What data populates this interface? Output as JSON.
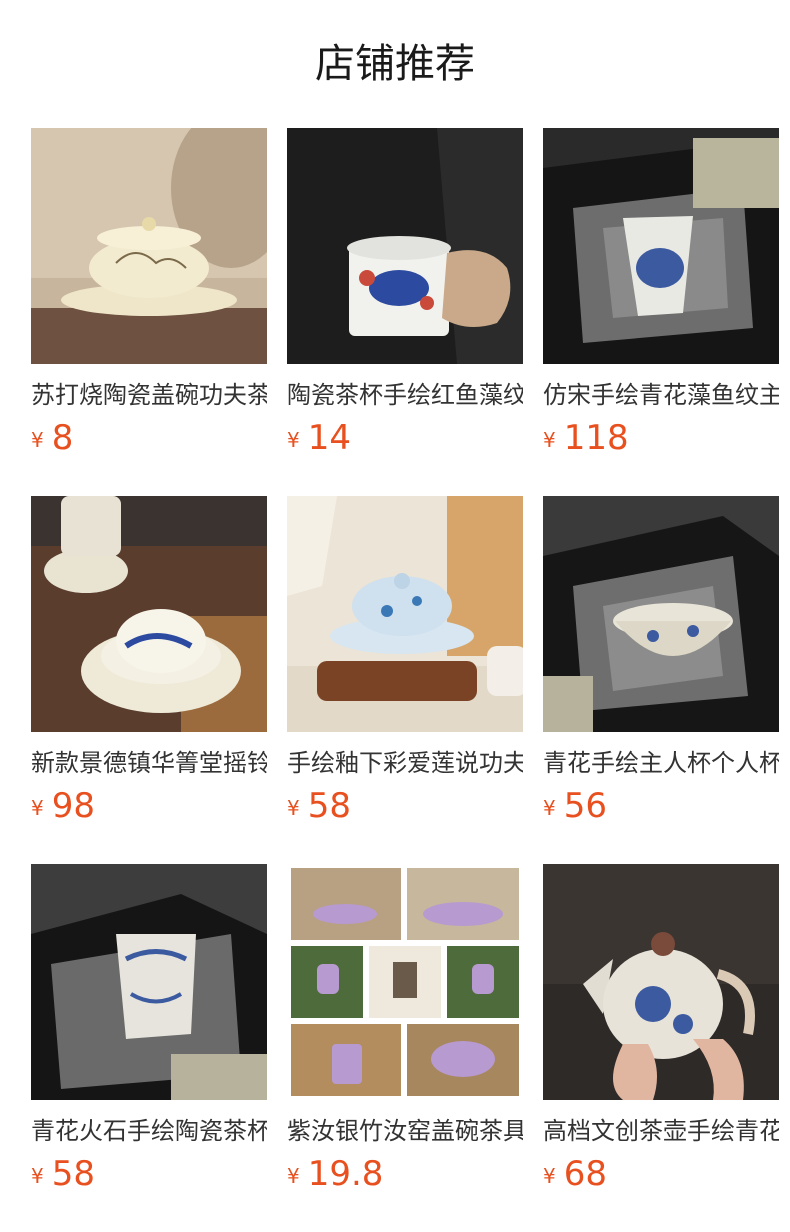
{
  "header": {
    "title": "店铺推荐"
  },
  "currency_symbol": "¥",
  "products": [
    {
      "name": "苏打烧陶瓷盖碗功夫茶具",
      "price": "8"
    },
    {
      "name": "陶瓷茶杯手绘红鱼藻纹主人杯",
      "price": "14"
    },
    {
      "name": "仿宋手绘青花藻鱼纹主人杯",
      "price": "118"
    },
    {
      "name": "新款景德镇华箐堂摇铃杯",
      "price": "98"
    },
    {
      "name": "手绘釉下彩爱莲说功夫茶具",
      "price": "58"
    },
    {
      "name": "青花手绘主人杯个人杯",
      "price": "56"
    },
    {
      "name": "青花火石手绘陶瓷茶杯",
      "price": "58"
    },
    {
      "name": "紫汝银竹汝窑盖碗茶具",
      "price": "19.8"
    },
    {
      "name": "高档文创茶壶手绘青花",
      "price": "68"
    }
  ]
}
